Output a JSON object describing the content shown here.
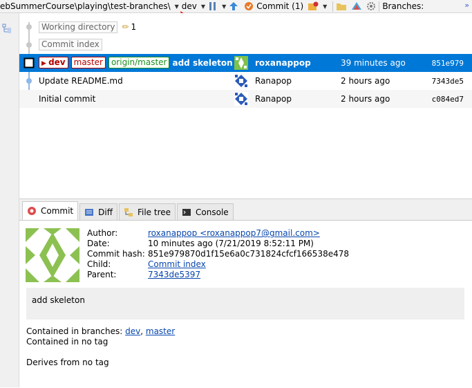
{
  "toolbar": {
    "path": "ebSummerCourse\\playing\\test-branches\\",
    "branch": "dev",
    "commit_label": "Commit (1)",
    "branches_label": "Branches:"
  },
  "graph": {
    "working_directory": "Working directory",
    "working_count": "1",
    "commit_index": "Commit index",
    "commits": [
      {
        "tags": [
          "dev",
          "master",
          "origin/master"
        ],
        "message": "add skeleton",
        "author": "roxanappop",
        "time": "39 minutes ago",
        "hash": "851e979"
      },
      {
        "message": "Update README.md",
        "author": "Ranapop",
        "time": "2 hours ago",
        "hash": "7343de5"
      },
      {
        "message": "Initial commit",
        "author": "Ranapop",
        "time": "2 hours ago",
        "hash": "c084ed7"
      }
    ]
  },
  "tabs": [
    "Commit",
    "Diff",
    "File tree",
    "Console"
  ],
  "details": {
    "labels": {
      "author": "Author:",
      "date": "Date:",
      "hash": "Commit hash:",
      "child": "Child:",
      "parent": "Parent:"
    },
    "author": "roxanappop <roxanappop7@gmail.com>",
    "date": "10 minutes ago (7/21/2019 8:52:11 PM)",
    "hash": "851e979870d1f15e6a0c731824cfcf166538e478",
    "child": "Commit index",
    "parent": "7343de5397",
    "message": "add skeleton",
    "contained_branches_label": "Contained in branches:",
    "branch_dev": "dev",
    "branch_master": "master",
    "contained_tag": "Contained in no tag",
    "derives": "Derives from no tag"
  },
  "colors": {
    "selection": "#0078d7",
    "graph_line": "#8fb7e8",
    "link": "#0645ad",
    "arrow": "#e01010"
  }
}
